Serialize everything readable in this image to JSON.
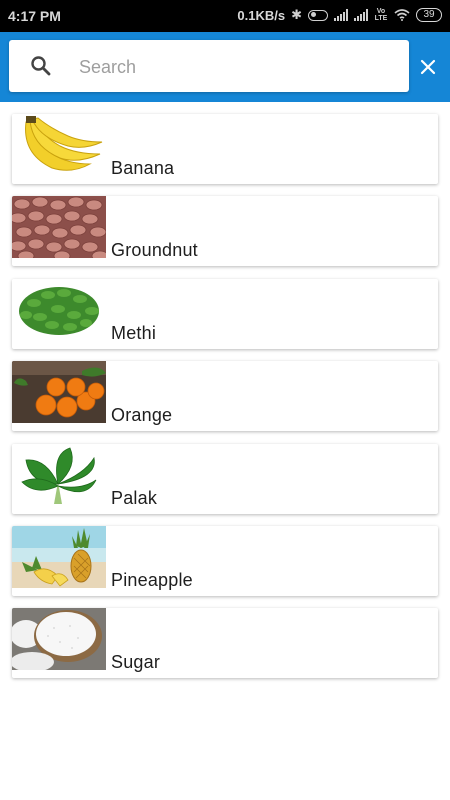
{
  "status_bar": {
    "time": "4:17 PM",
    "net_speed": "0.1KB/s",
    "battery": "39",
    "volte": "Vo LTE"
  },
  "search": {
    "placeholder": "Search",
    "value": ""
  },
  "items": [
    {
      "name": "Banana",
      "icon": "banana-image"
    },
    {
      "name": "Groundnut",
      "icon": "groundnut-image"
    },
    {
      "name": "Methi",
      "icon": "methi-image"
    },
    {
      "name": "Orange",
      "icon": "orange-image"
    },
    {
      "name": "Palak",
      "icon": "palak-image"
    },
    {
      "name": "Pineapple",
      "icon": "pineapple-image"
    },
    {
      "name": "Sugar",
      "icon": "sugar-image"
    }
  ],
  "colors": {
    "app_bar": "#1586d6",
    "status_bar": "#000000",
    "card_background": "#ffffff"
  }
}
